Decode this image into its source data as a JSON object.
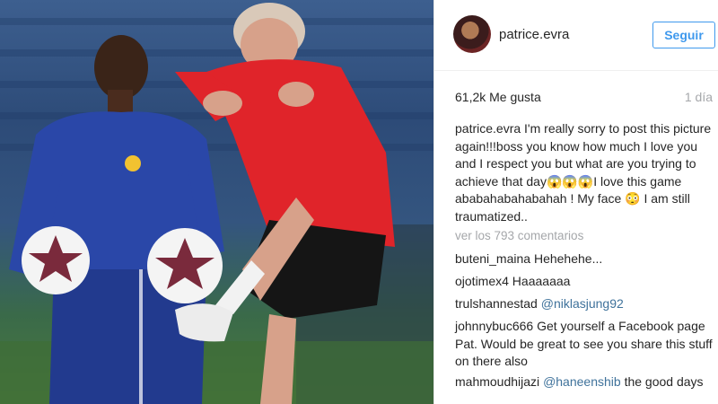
{
  "post": {
    "username": "patrice.evra",
    "follow_label": "Seguir",
    "likes": "61,2k Me gusta",
    "time_ago": "1 día",
    "caption_user": "patrice.evra",
    "caption_text": " I'm really sorry to post this picture again!!!boss you know how much I love you and I respect you but what are you trying to achieve that day😱😱😱I love this game ababahabahabahah ! My face 😳 I am still traumatized..",
    "view_all_comments": "ver los 793 comentarios"
  },
  "comments": [
    {
      "user": "buteni_maina",
      "text": " Hehehehe..."
    },
    {
      "user": "ojotimex4",
      "text": " Haaaaaaa"
    },
    {
      "user": "trulshannestad",
      "mention": "@niklasjung92",
      "text": ""
    },
    {
      "user": "johnnybuc666",
      "text": " Get yourself a Facebook page Pat. Would be great to see you share this stuff on there also"
    },
    {
      "user": "mahmoudhijazi",
      "mention": "@haneenshib",
      "text": " the good days"
    }
  ],
  "colors": {
    "follow_blue": "#3f99ed",
    "mention_blue": "#3f729b",
    "muted_gray": "#a5a7aa",
    "jersey_red": "#e0242a",
    "jersey_blue": "#2a47a8"
  },
  "icons": {
    "photo": "football-training-photo",
    "avatar": "user-avatar"
  }
}
